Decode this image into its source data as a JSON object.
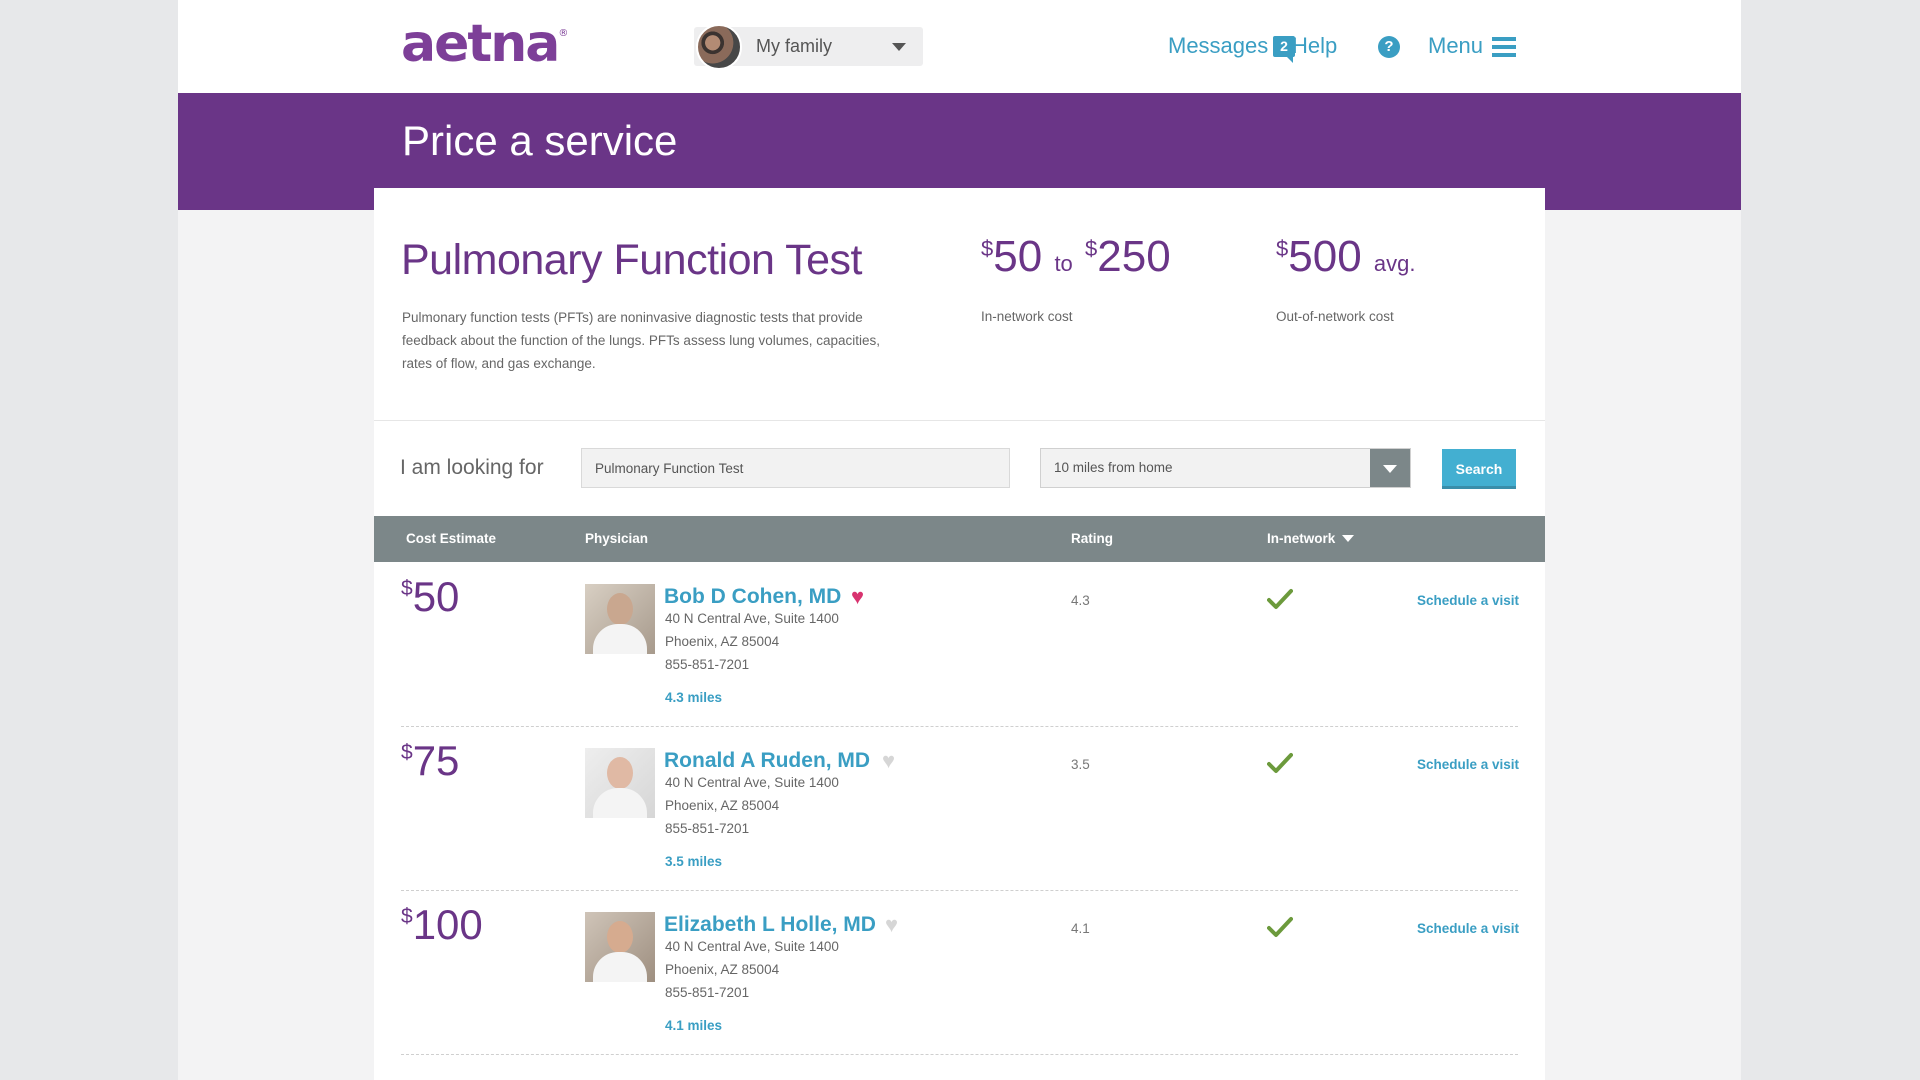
{
  "header": {
    "logo": "aetna",
    "logo_mark": "®",
    "member_selector": "My family",
    "nav": {
      "messages_label": "Messages",
      "messages_count": "2",
      "help_label": "Help",
      "help_icon": "?",
      "menu_label": "Menu"
    }
  },
  "page": {
    "title": "Price a service"
  },
  "service": {
    "name": "Pulmonary Function Test",
    "description": "Pulmonary function tests (PFTs) are noninvasive diagnostic tests that provide feedback about the function of the lungs. PFTs assess lung volumes, capacities, rates of flow, and gas exchange.",
    "in_network": {
      "currency": "$",
      "low": "50",
      "to": "to",
      "high": "250",
      "label": "In-network cost"
    },
    "out_of_network": {
      "currency": "$",
      "avg": "500",
      "avg_suffix": "avg.",
      "label": "Out-of-network cost"
    }
  },
  "search": {
    "prompt": "I am looking for",
    "query": "Pulmonary Function Test",
    "distance": "10 miles from home",
    "button": "Search"
  },
  "table": {
    "columns": {
      "cost": "Cost Estimate",
      "physician": "Physician",
      "rating": "Rating",
      "network": "In-network"
    },
    "rows": [
      {
        "currency": "$",
        "cost": "50",
        "name": "Bob D Cohen, MD",
        "favorite": true,
        "street": "40 N Central Ave, Suite 1400",
        "city": "Phoenix, AZ 85004",
        "phone": "855-851-7201",
        "distance": "4.3 miles",
        "rating": "4.3",
        "in_network": true,
        "action": "Schedule a visit"
      },
      {
        "currency": "$",
        "cost": "75",
        "name": "Ronald A Ruden, MD",
        "favorite": false,
        "street": "40 N Central Ave, Suite 1400",
        "city": "Phoenix, AZ 85004",
        "phone": "855-851-7201",
        "distance": "3.5 miles",
        "rating": "3.5",
        "in_network": true,
        "action": "Schedule a visit"
      },
      {
        "currency": "$",
        "cost": "100",
        "name": "Elizabeth L Holle, MD",
        "favorite": false,
        "street": "40 N Central Ave, Suite 1400",
        "city": "Phoenix, AZ 85004",
        "phone": "855-851-7201",
        "distance": "4.1 miles",
        "rating": "4.1",
        "in_network": true,
        "action": "Schedule a visit"
      }
    ]
  },
  "colors": {
    "brand_purple": "#6a3587",
    "link_blue": "#3a9ec3",
    "favorite_active": "#d8336f",
    "favorite_inactive": "#d6d6d6",
    "check_green": "#6c9a3c"
  }
}
